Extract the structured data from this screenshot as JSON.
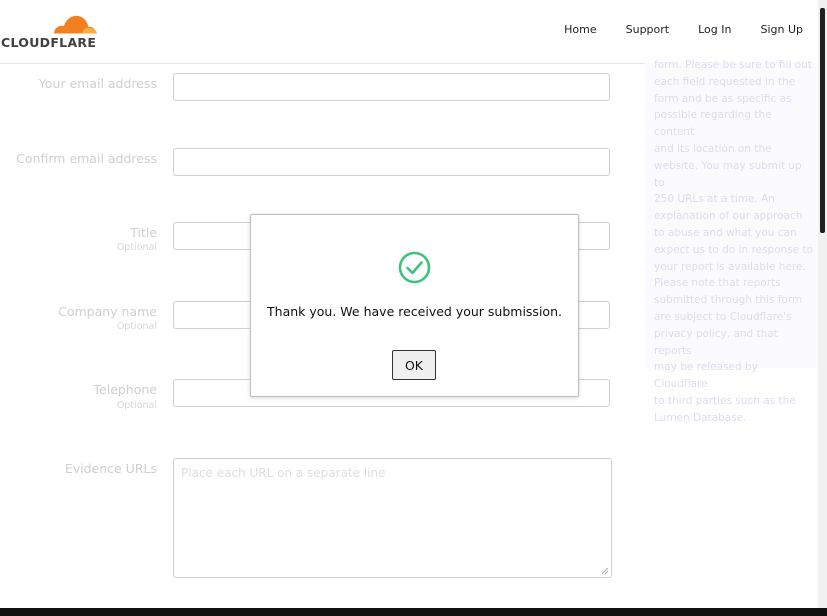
{
  "header": {
    "logo_text": "CLOUDFLARE",
    "nav": [
      "Home",
      "Support",
      "Log In",
      "Sign Up"
    ]
  },
  "form": {
    "email_label": "Your email address",
    "confirm_email_label": "Confirm email address",
    "title_label": "Title",
    "title_optional": "Optional",
    "company_label": "Company name",
    "company_optional": "Optional",
    "telephone_label": "Telephone",
    "telephone_optional": "Optional",
    "evidence_label": "Evidence URLs",
    "evidence_placeholder": "Place each URL on a separate line"
  },
  "sidebar": {
    "lines": [
      "form. Please be sure to fill out",
      "each field requested in the",
      "form and be as specific as",
      "possible regarding the content",
      "and its location on the",
      "website. You may submit up to",
      "250 URLs at a time. An",
      "explanation of our approach",
      "to abuse and what you can",
      "expect us to do in response to",
      "your report is available here.",
      "Please note that reports",
      "submitted through this form",
      "are subject to Cloudflare's",
      "privacy policy, and that reports",
      "may be released by Cloudflare",
      "to third parties such as the",
      "Lumen Database."
    ]
  },
  "modal": {
    "message": "Thank you. We have received your submission.",
    "ok_label": "OK",
    "icon": "check-circle-icon"
  },
  "colors": {
    "cloudflare_orange": "#f38020",
    "cloudflare_light_orange": "#faae40",
    "success_green": "#3cc37a"
  }
}
